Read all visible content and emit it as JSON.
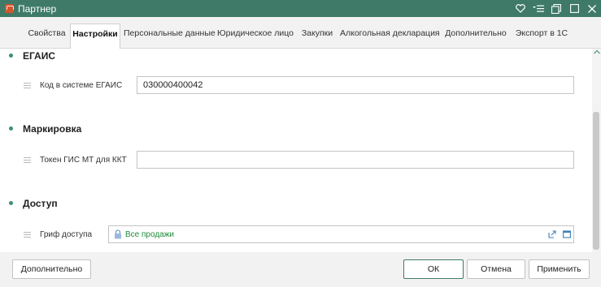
{
  "window": {
    "title": "Партнер"
  },
  "tabs": [
    {
      "label": "Свойства",
      "active": false
    },
    {
      "label": "Настройки",
      "active": true
    },
    {
      "label": "Персональные данные",
      "active": false
    },
    {
      "label": "Юридическое лицо",
      "active": false
    },
    {
      "label": "Закупки",
      "active": false
    },
    {
      "label": "Алкогольная декларация",
      "active": false
    },
    {
      "label": "Дополнительно",
      "active": false
    },
    {
      "label": "Экспорт в 1С",
      "active": false
    }
  ],
  "sections": {
    "egais": {
      "title": "ЕГАИС",
      "field_label": "Код в системе ЕГАИС",
      "field_value": "030000400042"
    },
    "marking": {
      "title": "Маркировка",
      "field_label": "Токен ГИС МТ для ККТ",
      "field_value": ""
    },
    "access": {
      "title": "Доступ",
      "field_label": "Гриф доступа",
      "field_value": "Все продажи"
    }
  },
  "footer": {
    "extra_label": "Дополнительно",
    "ok_label": "ОК",
    "cancel_label": "Отмена",
    "apply_label": "Применить"
  },
  "colors": {
    "titlebar": "#3f7a68",
    "accent": "#3d8f78",
    "access_value": "#1f8a3a"
  },
  "icons": {
    "window": "partner-window-icon",
    "favorite": "heart-icon",
    "menu": "menu-icon",
    "restore": "restore-icon",
    "maximize": "maximize-icon",
    "close": "close-icon",
    "lock": "lock-icon",
    "open": "open-link-icon",
    "select": "select-window-icon"
  }
}
